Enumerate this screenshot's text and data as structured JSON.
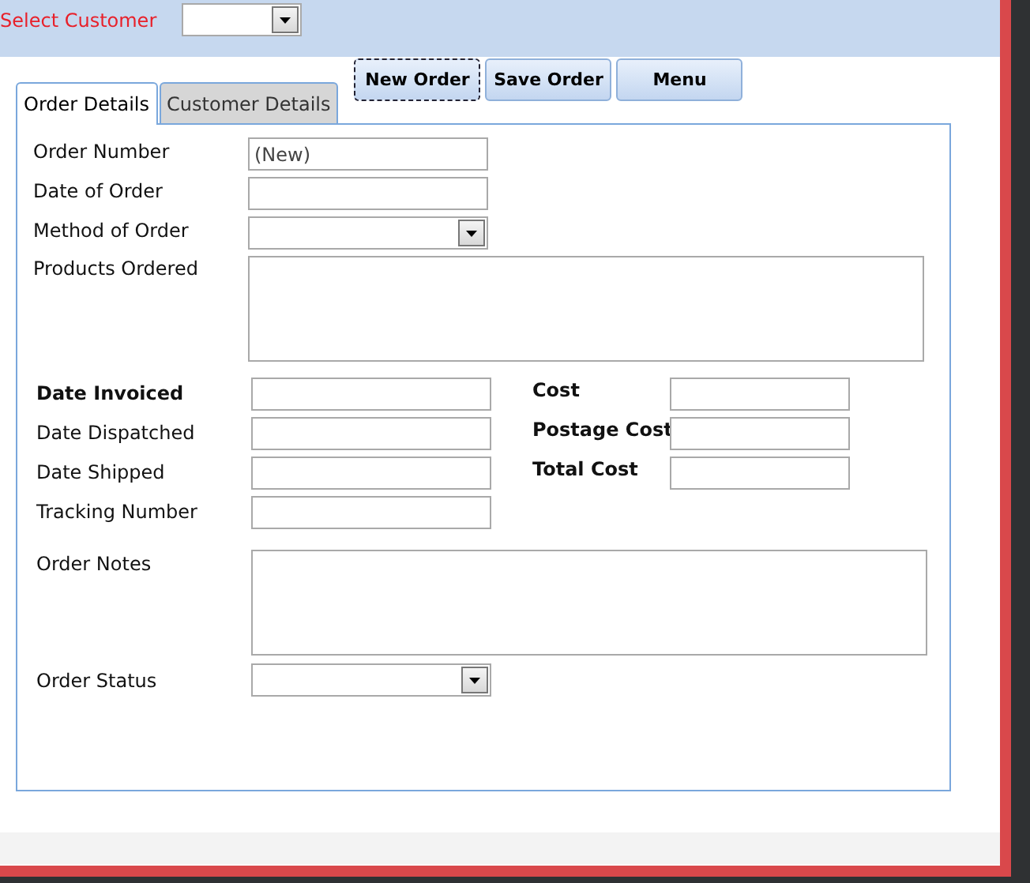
{
  "header": {
    "customer_label": "Select Customer"
  },
  "buttons": [
    {
      "label": "New Order",
      "focused": true
    },
    {
      "label": "Save Order",
      "focused": false
    },
    {
      "label": "Menu",
      "focused": false
    }
  ],
  "tabs": [
    {
      "label": "Order Details",
      "selected": true
    },
    {
      "label": "Customer Details",
      "selected": false
    }
  ],
  "order_fields": [
    {
      "label": "Order Number",
      "kind": "text",
      "value": "(New)"
    },
    {
      "label": "Date of Order",
      "kind": "text"
    },
    {
      "label": "Method of Order",
      "kind": "dropdown"
    },
    {
      "label": "Products Ordered",
      "kind": "textarea"
    }
  ],
  "invoice_fields": [
    {
      "label": "Date Invoiced",
      "kind": "text"
    },
    {
      "label": "Date Dispatched",
      "kind": "text"
    },
    {
      "label": "Date Shipped",
      "kind": "text"
    },
    {
      "label": "Tracking Number",
      "kind": "text"
    }
  ],
  "cost_fields": [
    {
      "label": "Cost",
      "kind": "text"
    },
    {
      "label": "Postage Cost",
      "kind": "text"
    },
    {
      "label": "Total Cost",
      "kind": "text"
    }
  ],
  "notes_fields": [
    {
      "label": "Order Notes",
      "kind": "textarea"
    },
    {
      "label": "Order Status",
      "kind": "dropdown"
    }
  ]
}
